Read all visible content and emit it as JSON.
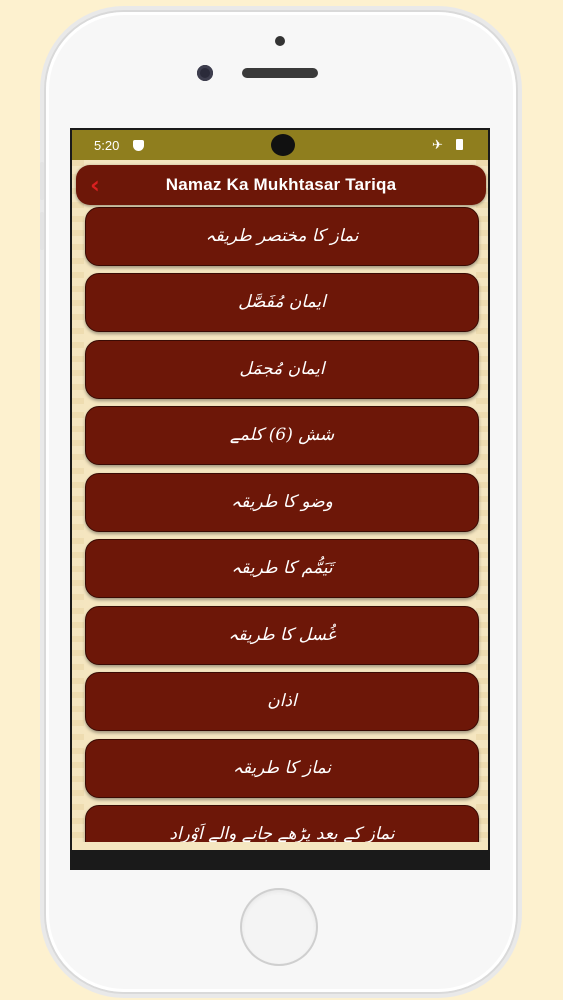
{
  "status_bar": {
    "time": "5:20",
    "icons": [
      "shield-icon",
      "airplane-icon",
      "battery-icon"
    ]
  },
  "header": {
    "title": "Namaz Ka Mukhtasar Tariqa",
    "back_icon": "chevron-left-icon"
  },
  "menu": {
    "items": [
      {
        "label": "نماز کا مختصر طریقہ"
      },
      {
        "label": "ایمان مُفَصَّل"
      },
      {
        "label": "ایمان مُجمَل"
      },
      {
        "label": "شش (6) کلمے"
      },
      {
        "label": "وضو کا طریقہ"
      },
      {
        "label": "تَیَمُّم کا طریقہ"
      },
      {
        "label": "غُسل کا طریقہ"
      },
      {
        "label": "اذان"
      },
      {
        "label": "نماز کا طریقہ"
      },
      {
        "label": "نماز کے بعد پڑھے جانے والے اَوْراد"
      }
    ]
  },
  "colors": {
    "page_bg": "#fdf1cf",
    "status_bar": "#8f7e1e",
    "item_bg": "#6d1708",
    "app_bg": "#f5e6c0",
    "back_icon": "#d92020"
  }
}
